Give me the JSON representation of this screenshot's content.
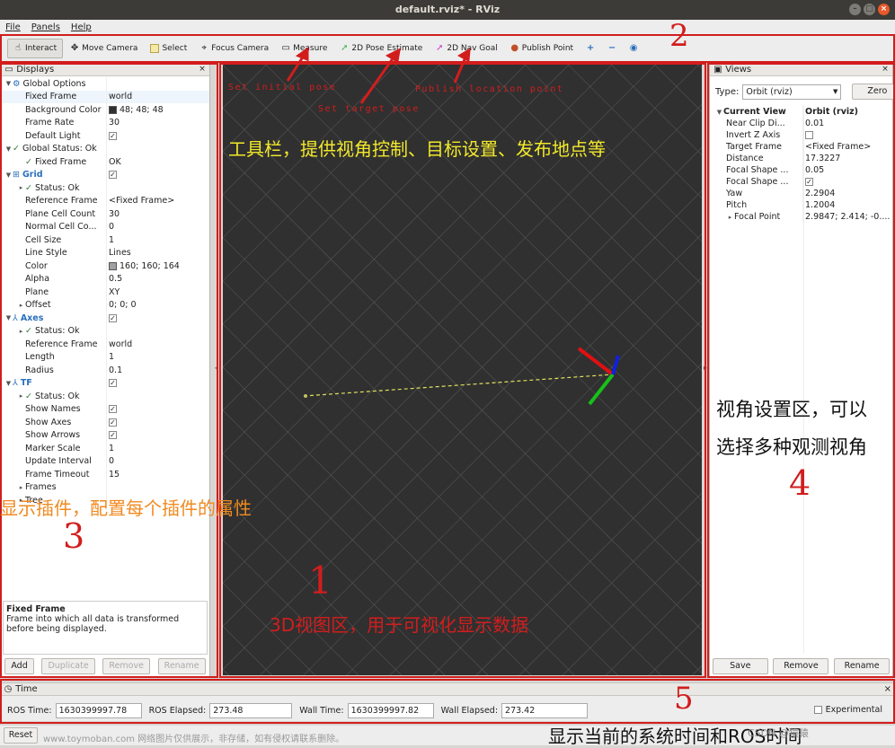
{
  "window": {
    "title": "default.rviz* - RViz"
  },
  "menu": [
    "File",
    "Panels",
    "Help"
  ],
  "toolbar": {
    "tools": [
      "Interact",
      "Move Camera",
      "Select",
      "Focus Camera",
      "Measure",
      "2D Pose Estimate",
      "2D Nav Goal",
      "Publish Point"
    ]
  },
  "displays": {
    "title": "Displays",
    "rows": [
      {
        "k": "Global Options",
        "v": "",
        "d": 0,
        "a": "▼",
        "ic": "⚙",
        "b": false
      },
      {
        "k": "Fixed Frame",
        "v": "world",
        "d": 1,
        "sel": true
      },
      {
        "k": "Background Color",
        "v": "48; 48; 48",
        "d": 1,
        "sw": "#303030"
      },
      {
        "k": "Frame Rate",
        "v": "30",
        "d": 1
      },
      {
        "k": "Default Light",
        "v": "✓",
        "d": 1,
        "cb": true
      },
      {
        "k": "Global Status: Ok",
        "v": "",
        "d": 0,
        "a": "▼",
        "ok": true
      },
      {
        "k": "Fixed Frame",
        "v": "OK",
        "d": 1,
        "ok": true
      },
      {
        "k": "Grid",
        "v": "✓",
        "d": 0,
        "a": "▼",
        "ic": "⊞",
        "blue": true,
        "cb": true
      },
      {
        "k": "Status: Ok",
        "v": "",
        "d": 1,
        "a": "▸",
        "ok": true
      },
      {
        "k": "Reference Frame",
        "v": "<Fixed Frame>",
        "d": 1
      },
      {
        "k": "Plane Cell Count",
        "v": "30",
        "d": 1
      },
      {
        "k": "Normal Cell Co...",
        "v": "0",
        "d": 1
      },
      {
        "k": "Cell Size",
        "v": "1",
        "d": 1
      },
      {
        "k": "Line Style",
        "v": "Lines",
        "d": 1
      },
      {
        "k": "Color",
        "v": "160; 160; 164",
        "d": 1,
        "sw": "#a0a0a4"
      },
      {
        "k": "Alpha",
        "v": "0.5",
        "d": 1
      },
      {
        "k": "Plane",
        "v": "XY",
        "d": 1
      },
      {
        "k": "Offset",
        "v": "0; 0; 0",
        "d": 1,
        "a": "▸"
      },
      {
        "k": "Axes",
        "v": "✓",
        "d": 0,
        "a": "▼",
        "ic": "⅄",
        "blue": true,
        "cb": true
      },
      {
        "k": "Status: Ok",
        "v": "",
        "d": 1,
        "a": "▸",
        "ok": true
      },
      {
        "k": "Reference Frame",
        "v": "world",
        "d": 1
      },
      {
        "k": "Length",
        "v": "1",
        "d": 1
      },
      {
        "k": "Radius",
        "v": "0.1",
        "d": 1
      },
      {
        "k": "TF",
        "v": "✓",
        "d": 0,
        "a": "▼",
        "ic": "⅄",
        "blue": true,
        "cb": true
      },
      {
        "k": "Status: Ok",
        "v": "",
        "d": 1,
        "a": "▸",
        "ok": true
      },
      {
        "k": "Show Names",
        "v": "✓",
        "d": 1,
        "cb": true
      },
      {
        "k": "Show Axes",
        "v": "✓",
        "d": 1,
        "cb": true
      },
      {
        "k": "Show Arrows",
        "v": "✓",
        "d": 1,
        "cb": true
      },
      {
        "k": "Marker Scale",
        "v": "1",
        "d": 1
      },
      {
        "k": "Update Interval",
        "v": "0",
        "d": 1
      },
      {
        "k": "Frame Timeout",
        "v": "15",
        "d": 1
      },
      {
        "k": "Frames",
        "v": "",
        "d": 1,
        "a": "▸"
      },
      {
        "k": "Tree",
        "v": "",
        "d": 1,
        "a": "▸"
      }
    ],
    "desc_title": "Fixed Frame",
    "desc_text": "Frame into which all data is transformed before being displayed.",
    "buttons": [
      "Add",
      "Duplicate",
      "Remove",
      "Rename"
    ]
  },
  "views": {
    "title": "Views",
    "type_label": "Type:",
    "type_value": "Orbit (rviz)",
    "zero": "Zero",
    "rows": [
      {
        "k": "Current View",
        "v": "Orbit (rviz)",
        "a": "▼",
        "b": true
      },
      {
        "k": "Near Clip Di...",
        "v": "0.01"
      },
      {
        "k": "Invert Z Axis",
        "v": "",
        "cb": true
      },
      {
        "k": "Target Frame",
        "v": "<Fixed Frame>"
      },
      {
        "k": "Distance",
        "v": "17.3227"
      },
      {
        "k": "Focal Shape ...",
        "v": "0.05"
      },
      {
        "k": "Focal Shape ...",
        "v": "✓",
        "cb": true
      },
      {
        "k": "Yaw",
        "v": "2.2904"
      },
      {
        "k": "Pitch",
        "v": "1.2004"
      },
      {
        "k": "Focal Point",
        "v": "2.9847; 2.414; -0....",
        "a": "▸"
      }
    ],
    "buttons": [
      "Save",
      "Remove",
      "Rename"
    ]
  },
  "time": {
    "title": "Time",
    "ros_time_label": "ROS Time:",
    "ros_time": "1630399997.78",
    "ros_elapsed_label": "ROS Elapsed:",
    "ros_elapsed": "273.48",
    "wall_time_label": "Wall Time:",
    "wall_time": "1630399997.82",
    "wall_elapsed_label": "Wall Elapsed:",
    "wall_elapsed": "273.42",
    "experimental": "Experimental",
    "reset": "Reset"
  },
  "annotations": {
    "n1": "1",
    "n2": "2",
    "n3": "3",
    "n4": "4",
    "n5": "5",
    "set_initial": "Set initial pose",
    "set_target": "Set target pose",
    "publish_loc": "Publish location point",
    "toolbar_cn": "工具栏，提供视角控制、目标设置、发布地点等",
    "display_cn": "显示插件，配置每个插件的属性",
    "view3d_cn": "3D视图区，用于可视化显示数据",
    "views_cn1": "视角设置区，可以",
    "views_cn2": "选择多种观测视角",
    "time_cn": "显示当前的系统时间和ROS时间",
    "watermark": "www.toymoban.com 网络图片仅供展示，非存储，如有侵权请联系删除。",
    "csdn": "CSDN @猿猿"
  },
  "colors": {
    "annotation": "#d21d1d",
    "yellow_text": "#f2e92a",
    "orange_text": "#f08a20",
    "bg3d": "#303030"
  }
}
